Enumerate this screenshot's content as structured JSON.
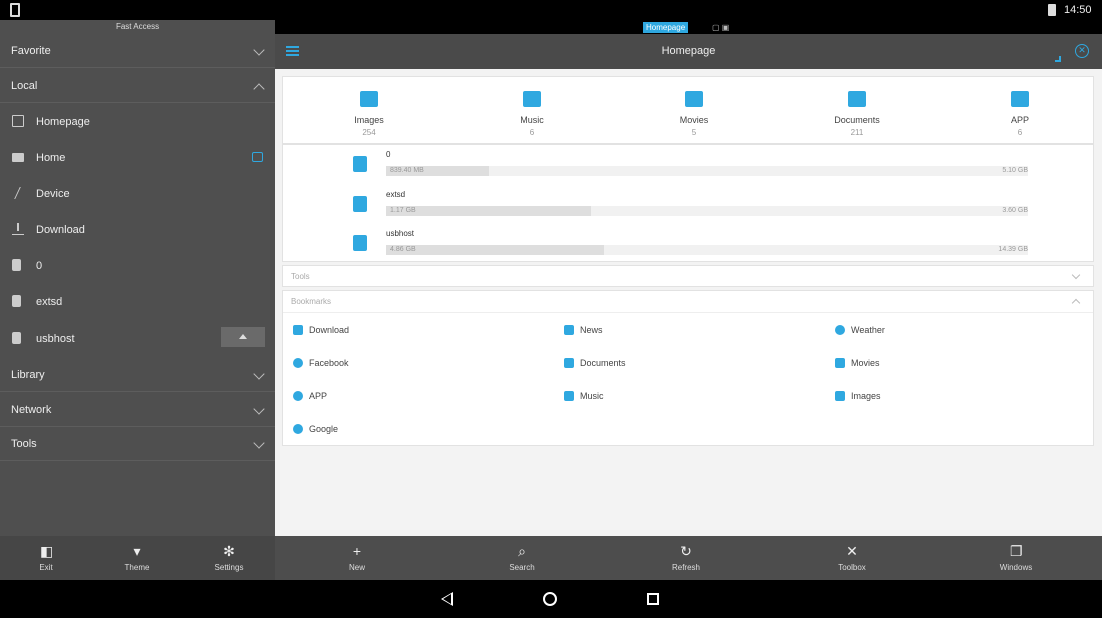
{
  "status_bar": {
    "time": "14:50"
  },
  "drawer": {
    "title": "Fast Access",
    "sections": {
      "favorite": "Favorite",
      "local": "Local",
      "library": "Library",
      "network": "Network",
      "tools": "Tools"
    },
    "local_items": [
      "Homepage",
      "Home",
      "Device",
      "Download",
      "0",
      "extsd",
      "usbhost"
    ]
  },
  "window": {
    "tab_label": "Homepage",
    "title": "Homepage"
  },
  "categories": [
    {
      "name": "Images",
      "count": "254",
      "icon": "image-icon"
    },
    {
      "name": "Music",
      "count": "6",
      "icon": "music-icon"
    },
    {
      "name": "Movies",
      "count": "5",
      "icon": "movie-icon"
    },
    {
      "name": "Documents",
      "count": "211",
      "icon": "documents-icon"
    },
    {
      "name": "APP",
      "count": "6",
      "icon": "android-icon"
    }
  ],
  "storage": [
    {
      "name": "0",
      "used": "839.40 MB",
      "total": "5.10 GB",
      "used_fraction": 0.16
    },
    {
      "name": "extsd",
      "used": "1.17 GB",
      "total": "3.60 GB",
      "used_fraction": 0.32
    },
    {
      "name": "usbhost",
      "used": "4.86 GB",
      "total": "14.39 GB",
      "used_fraction": 0.34
    }
  ],
  "tools_section": {
    "title": "Tools"
  },
  "bookmarks_section": {
    "title": "Bookmarks",
    "items": [
      {
        "label": "Download",
        "icon": "download-icon"
      },
      {
        "label": "News",
        "icon": "news-icon"
      },
      {
        "label": "Weather",
        "icon": "weather-icon"
      },
      {
        "label": "Facebook",
        "icon": "globe-icon"
      },
      {
        "label": "Documents",
        "icon": "documents-icon"
      },
      {
        "label": "Movies",
        "icon": "movie-icon"
      },
      {
        "label": "APP",
        "icon": "android-icon"
      },
      {
        "label": "Music",
        "icon": "music-icon"
      },
      {
        "label": "Images",
        "icon": "image-icon"
      },
      {
        "label": "Google",
        "icon": "globe-icon"
      }
    ]
  },
  "toolbar": {
    "exit": "Exit",
    "theme": "Theme",
    "settings": "Settings",
    "new": "New",
    "search": "Search",
    "refresh": "Refresh",
    "toolbox": "Toolbox",
    "windows": "Windows"
  },
  "colors": {
    "accent": "#2fa8e0",
    "drawer_bg": "#4f4f4f",
    "content_bg": "#f3f3f3"
  }
}
